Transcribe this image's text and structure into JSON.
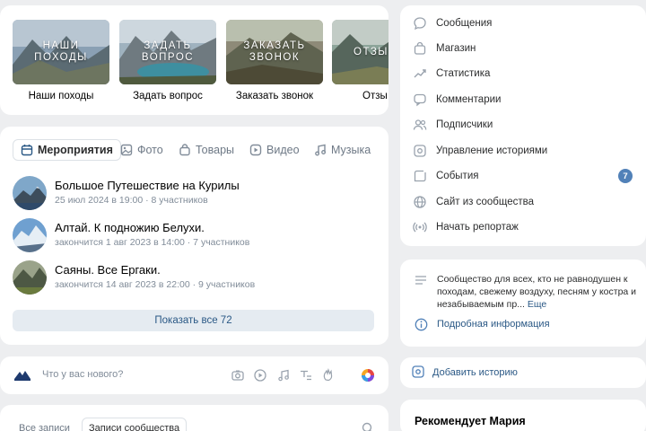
{
  "quick_links": [
    {
      "overlay": "НАШИ\nПОХОДЫ",
      "caption": "Наши походы"
    },
    {
      "overlay": "ЗАДАТЬ\nВОПРОС",
      "caption": "Задать вопрос"
    },
    {
      "overlay": "ЗАКАЗАТЬ\nЗВОНОК",
      "caption": "Заказать звонок"
    },
    {
      "overlay": "ОТЗЫ",
      "caption": "Отзы"
    }
  ],
  "section_tabs": [
    {
      "label": "Мероприятия",
      "icon": "calendar-icon",
      "active": true
    },
    {
      "label": "Фото",
      "icon": "photo-icon"
    },
    {
      "label": "Товары",
      "icon": "bag-icon"
    },
    {
      "label": "Видео",
      "icon": "video-icon"
    },
    {
      "label": "Музыка",
      "icon": "music-icon"
    }
  ],
  "events": [
    {
      "title": "Большое Путешествие на Курилы",
      "subtitle": "25 июл 2024 в 19:00 · 8 участников"
    },
    {
      "title": "Алтай. К подножию Белухи.",
      "subtitle": "закончится 1 авг 2023 в 14:00 · 7 участников"
    },
    {
      "title": "Саяны. Все Ергаки.",
      "subtitle": "закончится 14 авг 2023 в 22:00 · 9 участников"
    }
  ],
  "show_all_label": "Показать все 72",
  "composer": {
    "placeholder": "Что у вас нового?"
  },
  "wall_tabs": [
    {
      "label": "Все записи"
    },
    {
      "label": "Записи сообщества",
      "active": true
    }
  ],
  "menu": [
    {
      "label": "Сообщения",
      "icon": "message-icon"
    },
    {
      "label": "Магазин",
      "icon": "shop-icon"
    },
    {
      "label": "Статистика",
      "icon": "stats-icon"
    },
    {
      "label": "Комментарии",
      "icon": "comments-icon"
    },
    {
      "label": "Подписчики",
      "icon": "users-icon"
    },
    {
      "label": "Управление историями",
      "icon": "stories-icon"
    },
    {
      "label": "События",
      "icon": "events-icon",
      "badge": "7"
    },
    {
      "label": "Сайт из сообщества",
      "icon": "globe-icon"
    },
    {
      "label": "Начать репортаж",
      "icon": "broadcast-icon"
    }
  ],
  "info": {
    "description": "Сообщество для всех, кто не равнодушен к походам, свежему воздуху, песням у костра и незабываемым пр...",
    "more_label": "Еще",
    "details_link": "Подробная информация"
  },
  "add_story_label": "Добавить историю",
  "recommend_title": "Рекомендует Мария",
  "colors": {
    "accent": "#2a5885",
    "badge": "#5181b8",
    "background": "#edeef0"
  }
}
